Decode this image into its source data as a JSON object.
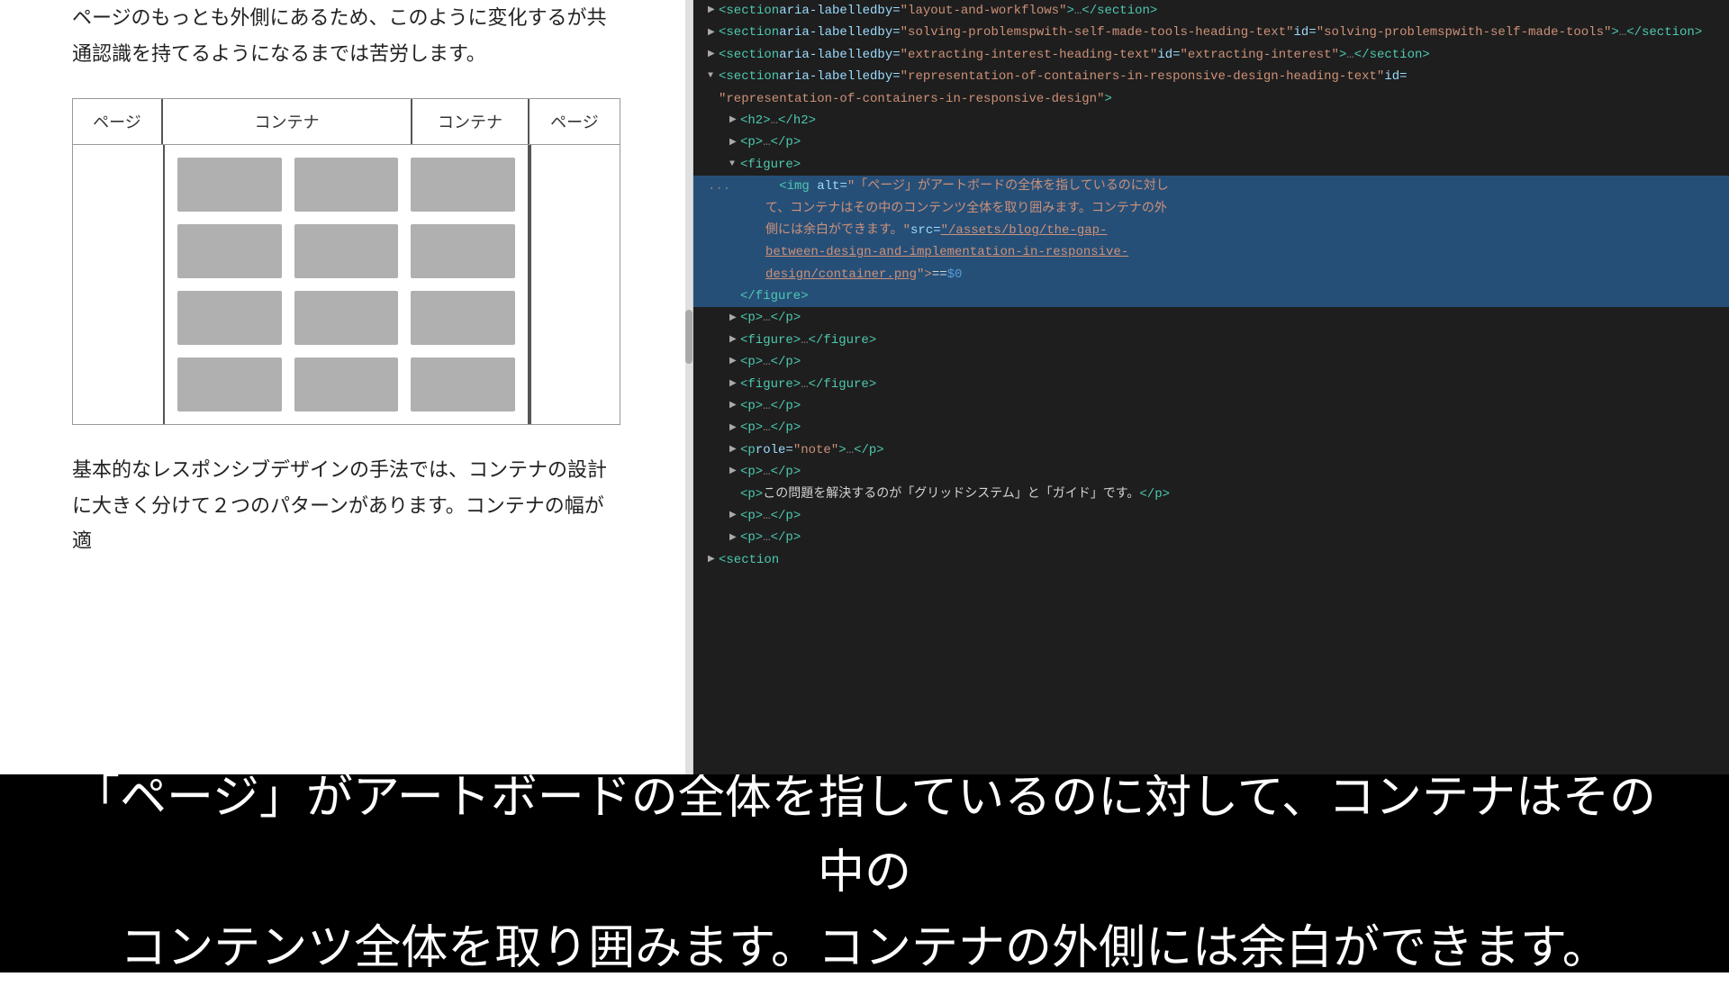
{
  "article": {
    "top_text": "ページのもっとも外側にあるため、このように変化するが共\n通認識を持てるようになるまでは苦労します。",
    "diagram": {
      "label_page_left": "ページ",
      "label_container_left": "コンテナ",
      "label_container_right": "コンテナ",
      "label_page_right": "ページ",
      "grid_rows": 4,
      "grid_cols": 3
    },
    "bottom_text": "基本的なレスポンシブデザインの手法では、コンテナの設計\nに大きく分けて２つのパターンがあります。コンテナの幅が適"
  },
  "devtools": {
    "lines": [
      {
        "indent": 0,
        "triangle": "▶",
        "highlighted": false,
        "content": "<section aria-labelledby=\"layout-and-workflows\">…</section>"
      },
      {
        "indent": 0,
        "triangle": "▶",
        "highlighted": false,
        "content": "<section aria-labelledby=\"solving-problemspwith-self-made-tools-heading-text\" id=\"solving-problemspwith-self-made-tools\">…</section>"
      },
      {
        "indent": 0,
        "triangle": "▶",
        "highlighted": false,
        "content": "<section aria-labelledby=\"extracting-interest-heading-text\" id=\"extracting-interest\">…</section>"
      },
      {
        "indent": 0,
        "triangle": "▼",
        "highlighted": false,
        "content": "<section aria-labelledby=\"representation-of-containers-in-responsive-design-heading-text\" id=\"representation-of-containers-in-responsive-design\">"
      },
      {
        "indent": 1,
        "triangle": "▶",
        "highlighted": false,
        "content": "<h2>…</h2>"
      },
      {
        "indent": 1,
        "triangle": "▶",
        "highlighted": false,
        "content": "<p>…</p>"
      },
      {
        "indent": 1,
        "triangle": "▼",
        "highlighted": false,
        "content": "<figure>"
      },
      {
        "indent": 2,
        "triangle": "",
        "highlighted": true,
        "dots": true,
        "content": "<img alt=\"「ページ」がアートボードの全体を指しているのに対して、コンテナはその中のコンテンツ全体を取り囲みます。コンテナの外側には余白ができます。\" src=\"/assets/blog/the-gap-between-design-and-implementation-in-responsive-design/container.png\"> == $0"
      },
      {
        "indent": 1,
        "triangle": "",
        "highlighted": true,
        "content": "</figure>"
      },
      {
        "indent": 1,
        "triangle": "▶",
        "highlighted": false,
        "content": "<p>…</p>"
      },
      {
        "indent": 1,
        "triangle": "▶",
        "highlighted": false,
        "content": "<figure>…</figure>"
      },
      {
        "indent": 1,
        "triangle": "▶",
        "highlighted": false,
        "content": "<p>…</p>"
      },
      {
        "indent": 1,
        "triangle": "▶",
        "highlighted": false,
        "content": "<figure>…</figure>"
      },
      {
        "indent": 1,
        "triangle": "▶",
        "highlighted": false,
        "content": "<p>…</p>"
      },
      {
        "indent": 1,
        "triangle": "▶",
        "highlighted": false,
        "content": "<p>…</p>"
      },
      {
        "indent": 1,
        "triangle": "▶",
        "highlighted": false,
        "content": "<p role=\"note\">…</p>"
      },
      {
        "indent": 1,
        "triangle": "▶",
        "highlighted": false,
        "content": "<p>…</p>"
      },
      {
        "indent": 1,
        "triangle": "",
        "highlighted": false,
        "content": "<p>この問題を解決するのが「グリッドシステム」と「ガイド」です。</p>"
      },
      {
        "indent": 1,
        "triangle": "▶",
        "highlighted": false,
        "content": "<p>…</p>"
      },
      {
        "indent": 1,
        "triangle": "▶",
        "highlighted": false,
        "content": "<p>…</p>"
      },
      {
        "indent": 0,
        "triangle": "▶",
        "highlighted": false,
        "content": "<section"
      }
    ]
  },
  "caption": {
    "text": "「ページ」がアートボードの全体を指しているのに対して、コンテナはその中の\nコンテンツ全体を取り囲みます。コンテナの外側には余白ができます。"
  }
}
